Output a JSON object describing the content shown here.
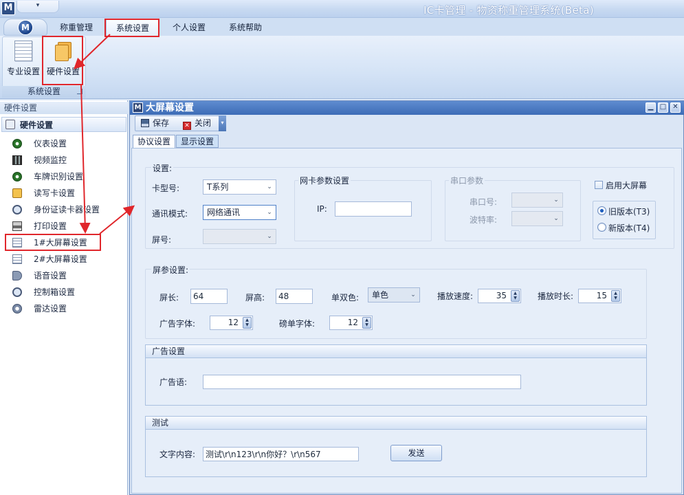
{
  "window": {
    "title": "IC卡管理 - 物资称重管理系统(Beta)",
    "logo": "M",
    "quick_access": "▾"
  },
  "menu": {
    "orb": "M",
    "items": [
      "称重管理",
      "系统设置",
      "个人设置",
      "系统帮助"
    ],
    "active": "系统设置"
  },
  "ribbon": {
    "buttons": [
      {
        "label": "专业设置",
        "icon": "document-icon"
      },
      {
        "label": "硬件设置",
        "icon": "folder-icon"
      }
    ],
    "group_label": "系统设置"
  },
  "left_pane": {
    "caption": "硬件设置",
    "group_header": "硬件设置",
    "items": [
      {
        "label": "仪表设置",
        "icon": "clock-icon"
      },
      {
        "label": "视频监控",
        "icon": "film-icon"
      },
      {
        "label": "车牌识别设置",
        "icon": "clock-icon"
      },
      {
        "label": "读写卡设置",
        "icon": "card-icon"
      },
      {
        "label": "身份证读卡器设置",
        "icon": "magnifier-icon"
      },
      {
        "label": "打印设置",
        "icon": "printer-icon"
      },
      {
        "label": "1#大屏幕设置",
        "icon": "document-icon"
      },
      {
        "label": "2#大屏幕设置",
        "icon": "document-icon"
      },
      {
        "label": "语音设置",
        "icon": "horn-icon"
      },
      {
        "label": "控制箱设置",
        "icon": "magnifier-icon"
      },
      {
        "label": "雷达设置",
        "icon": "gauge-icon"
      }
    ],
    "selected": "1#大屏幕设置"
  },
  "child_window": {
    "logo": "M",
    "title": "大屏幕设置",
    "buttons": {
      "minimize": "▁",
      "maximize": "□",
      "close": "✕"
    },
    "toolbar": {
      "save": "保存",
      "close": "关闭",
      "more": "▾",
      "close_glyph": "✕"
    },
    "tabs": [
      "协议设置",
      "显示设置"
    ],
    "active_tab": "协议设置"
  },
  "settings": {
    "legend": "设置:",
    "card_type_label": "卡型号:",
    "card_type_value": "T系列",
    "comm_mode_label": "通讯模式:",
    "comm_mode_value": "网络通讯",
    "screen_no_label": "屏号:",
    "screen_no_value": "",
    "network": {
      "legend": "网卡参数设置",
      "ip_label": "IP:",
      "ip_value": ""
    },
    "serial": {
      "legend": "串口参数",
      "port_label": "串口号:",
      "baud_label": "波特率:"
    },
    "enable_big_screen": {
      "label": "启用大屏幕",
      "checked": false
    },
    "version": {
      "options": [
        "旧版本(T3)",
        "新版本(T4)"
      ],
      "selected": "旧版本(T3)"
    }
  },
  "screen_params": {
    "legend": "屏参设置:",
    "width_label": "屏长:",
    "width_value": "64",
    "height_label": "屏高:",
    "height_value": "48",
    "color_label": "单双色:",
    "color_value": "单色",
    "speed_label": "播放速度:",
    "speed_value": "35",
    "duration_label": "播放时长:",
    "duration_value": "15",
    "ad_font_label": "广告字体:",
    "ad_font_value": "12",
    "weigh_font_label": "磅单字体:",
    "weigh_font_value": "12"
  },
  "ad_section": {
    "title": "广告设置",
    "label": "广告语:",
    "value": ""
  },
  "test_section": {
    "title": "测试",
    "label": "文字内容:",
    "value": "测试\\r\\n123\\r\\n你好？\\r\\n567",
    "send": "发送"
  },
  "colors": {
    "annotation": "#e0262b",
    "accent": "#3d6cb6"
  },
  "combo_arrow": "⌄",
  "spin_arrows": [
    "▲",
    "▼"
  ]
}
